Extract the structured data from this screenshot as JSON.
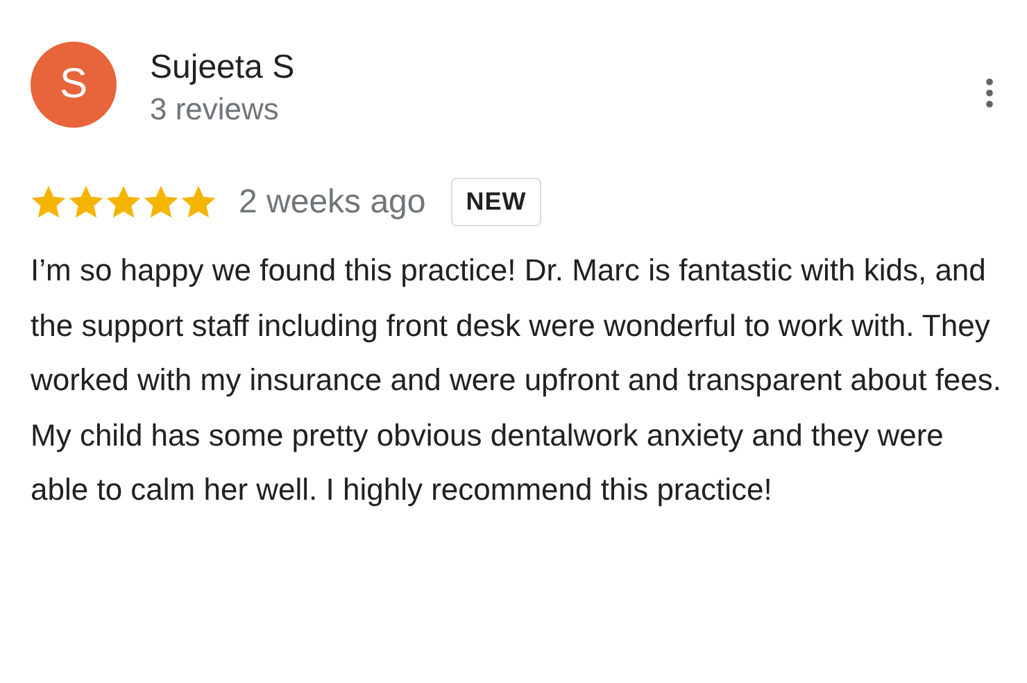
{
  "reviewer": {
    "initial": "S",
    "name": "Sujeeta S",
    "review_count": "3 reviews"
  },
  "review": {
    "stars": 5,
    "time": "2 weeks ago",
    "badge": "NEW",
    "text": "I’m so happy we found this practice! Dr. Marc is fantastic with kids, and the support staff including front desk were wonderful to work with. They worked with my insurance and were upfront and transparent about fees. My child has some pretty obvious dentalwork anxiety and they were able to calm her well. I highly recommend this practice!"
  }
}
